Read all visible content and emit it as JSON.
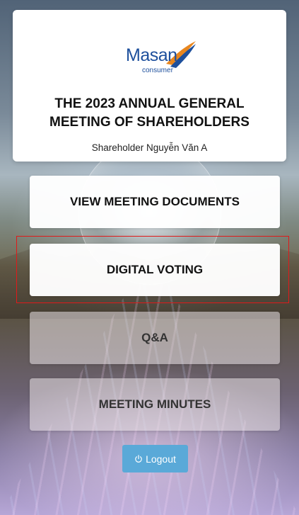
{
  "brand": {
    "name": "Masan",
    "sub": "consumer",
    "color": "#1d4f9c",
    "accent": "#e8861e"
  },
  "meeting": {
    "title_line1": "THE 2023 ANNUAL GENERAL",
    "title_line2": "MEETING OF SHAREHOLDERS",
    "shareholder": "Shareholder Nguyễn Văn A"
  },
  "menu": {
    "view_documents": "VIEW MEETING DOCUMENTS",
    "digital_voting": "DIGITAL VOTING",
    "qa": "Q&A",
    "meeting_minutes": "MEETING MINUTES"
  },
  "logout": {
    "label": "Logout",
    "icon": "power-icon",
    "color": "#5aa9d8"
  },
  "highlight": {
    "color": "#e01a1a",
    "target": "digital-voting-button"
  }
}
